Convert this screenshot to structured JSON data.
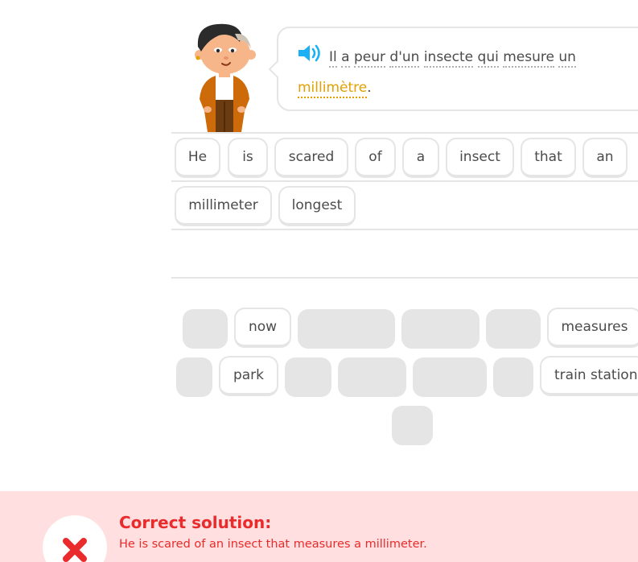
{
  "prompt": {
    "tokens_line1": [
      "Il",
      "a",
      "peur",
      "d'un",
      "insecte",
      "qui",
      "mesure",
      "un"
    ],
    "highlighted_word": "millimètre",
    "end_punct": "."
  },
  "answer_tiles": [
    {
      "label": "He"
    },
    {
      "label": "is"
    },
    {
      "label": "scared"
    },
    {
      "label": "of"
    },
    {
      "label": "a"
    },
    {
      "label": "insect"
    },
    {
      "label": "that"
    },
    {
      "label": "an"
    },
    {
      "label": "millimeter"
    },
    {
      "label": "longest"
    }
  ],
  "word_bank": {
    "visible": [
      {
        "label": "now"
      },
      {
        "label": "measures"
      },
      {
        "label": "park"
      },
      {
        "label": "train station"
      }
    ]
  },
  "feedback": {
    "title": "Correct solution:",
    "solution": "He is scared of an insect that measures a millimeter."
  },
  "colors": {
    "highlight": "#e5a000",
    "error": "#ea2b2b",
    "error_bg": "#ffdfe0",
    "border": "#e5e5e5",
    "speaker": "#1cb0f6"
  },
  "icons": {
    "speaker": "speaker-icon",
    "wrong": "x-mark-icon",
    "character": "character-illustration"
  }
}
